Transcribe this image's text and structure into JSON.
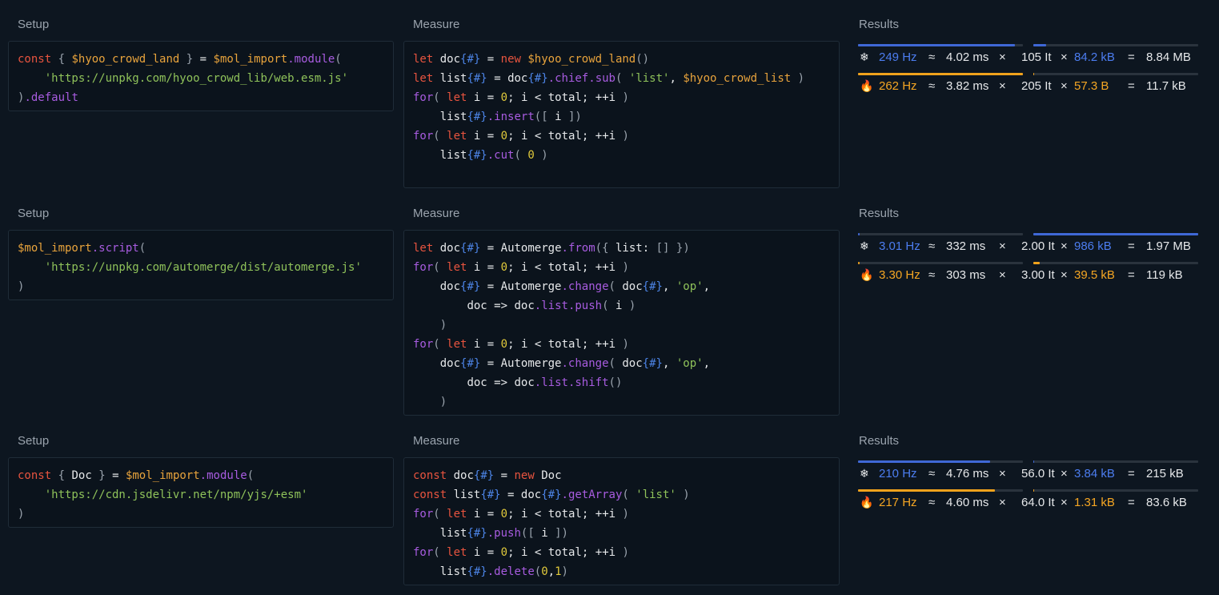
{
  "labels": {
    "setup": "Setup",
    "measure": "Measure",
    "results": "Results"
  },
  "colors": {
    "background": "#0d1620",
    "cold_bar": "#3f68d6",
    "hot_bar": "#f0a21c",
    "cold_text": "#4c7df0",
    "hot_text": "#f5a623"
  },
  "icons": {
    "cold": "snowflake-icon",
    "hot": "fire-icon"
  },
  "cases": [
    {
      "setup_lines": [
        "const { $hyoo_crowd_land } = $mol_import.module(",
        "    'https://unpkg.com/hyoo_crowd_lib/web.esm.js'",
        ").default"
      ],
      "measure_lines": [
        "let doc{#} = new $hyoo_crowd_land()",
        "let list{#} = doc{#}.chief.sub( 'list', $hyoo_crowd_list )",
        "for( let i = 0; i < total; ++i )",
        "    list{#}.insert([ i ])",
        "for( let i = 0; i < total; ++i )",
        "    list{#}.cut( 0 )"
      ],
      "cold": {
        "freq": "249 Hz",
        "time": "4.02 ms",
        "iter": "105 It",
        "mem": "84.2 kB",
        "total": "8.84 MB",
        "freq_level": 0.95,
        "mem_level": 0.08
      },
      "hot": {
        "freq": "262 Hz",
        "time": "3.82 ms",
        "iter": "205 It",
        "mem": "57.3 B",
        "total": "11.7 kB",
        "freq_level": 1.0,
        "mem_level": 0.0
      }
    },
    {
      "setup_lines": [
        "$mol_import.script(",
        "    'https://unpkg.com/automerge/dist/automerge.js'",
        ")"
      ],
      "measure_lines": [
        "let doc{#} = Automerge.from({ list: [] })",
        "for( let i = 0; i < total; ++i )",
        "    doc{#} = Automerge.change( doc{#}, 'op',",
        "        doc => doc.list.push( i )",
        "    )",
        "for( let i = 0; i < total; ++i )",
        "    doc{#} = Automerge.change( doc{#}, 'op',",
        "        doc => doc.list.shift()",
        "    )"
      ],
      "cold": {
        "freq": "3.01 Hz",
        "time": "332 ms",
        "iter": "2.00 It",
        "mem": "986 kB",
        "total": "1.97 MB",
        "freq_level": 0.01,
        "mem_level": 1.0
      },
      "hot": {
        "freq": "3.30 Hz",
        "time": "303 ms",
        "iter": "3.00 It",
        "mem": "39.5 kB",
        "total": "119 kB",
        "freq_level": 0.01,
        "mem_level": 0.04
      }
    },
    {
      "setup_lines": [
        "const { Doc } = $mol_import.module(",
        "    'https://cdn.jsdelivr.net/npm/yjs/+esm'",
        ")"
      ],
      "measure_lines": [
        "const doc{#} = new Doc",
        "const list{#} = doc{#}.getArray( 'list' )",
        "for( let i = 0; i < total; ++i )",
        "    list{#}.push([ i ])",
        "for( let i = 0; i < total; ++i )",
        "    list{#}.delete(0,1)"
      ],
      "cold": {
        "freq": "210 Hz",
        "time": "4.76 ms",
        "iter": "56.0 It",
        "mem": "3.84 kB",
        "total": "215 kB",
        "freq_level": 0.8,
        "mem_level": 0.0
      },
      "hot": {
        "freq": "217 Hz",
        "time": "4.60 ms",
        "iter": "64.0 It",
        "mem": "1.31 kB",
        "total": "83.6 kB",
        "freq_level": 0.83,
        "mem_level": 0.0
      }
    }
  ]
}
